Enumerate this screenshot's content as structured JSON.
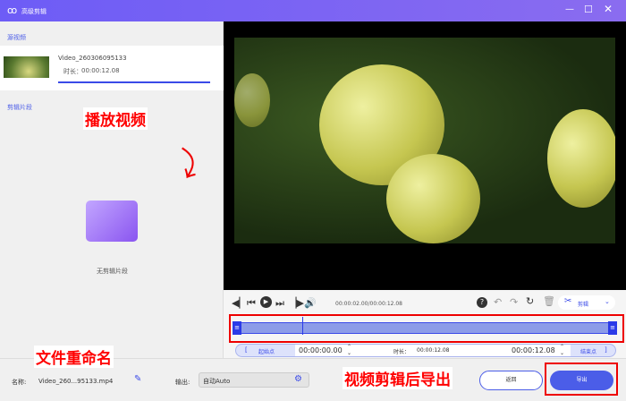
{
  "window": {
    "title": "高级剪辑",
    "controls": [
      "minimize",
      "maximize",
      "close"
    ]
  },
  "sidebar": {
    "source_header": "源视频",
    "video_name": "Video_260306095133",
    "duration_label": "时长：",
    "duration": "00:00:12.08",
    "clips_header": "剪辑片段",
    "empty_text": "无剪辑片段"
  },
  "player": {
    "time": "00:00:02.00/00:00:12.08",
    "cut_label": "剪辑",
    "progress_fraction": 0.166
  },
  "range": {
    "start_label": "起始点",
    "start_value": "00:00:00.00",
    "duration_label": "时长：",
    "duration_value": "00:00:12.08",
    "end_value": "00:00:12.08",
    "end_label": "结束点",
    "open_bracket": "[",
    "close_bracket": "]"
  },
  "bottom": {
    "name_label": "名称:",
    "name_value": "Video_260...95133.mp4",
    "output_label": "输出:",
    "output_value": "自动Auto",
    "back_label": "返回",
    "export_label": "导出"
  },
  "annotations": {
    "play": "播放视频",
    "rename": "文件重命名",
    "export": "视频剪辑后导出"
  },
  "colors": {
    "accent": "#4b5de8",
    "titlebar": "#7160f4",
    "annotation": "#ff0000"
  }
}
